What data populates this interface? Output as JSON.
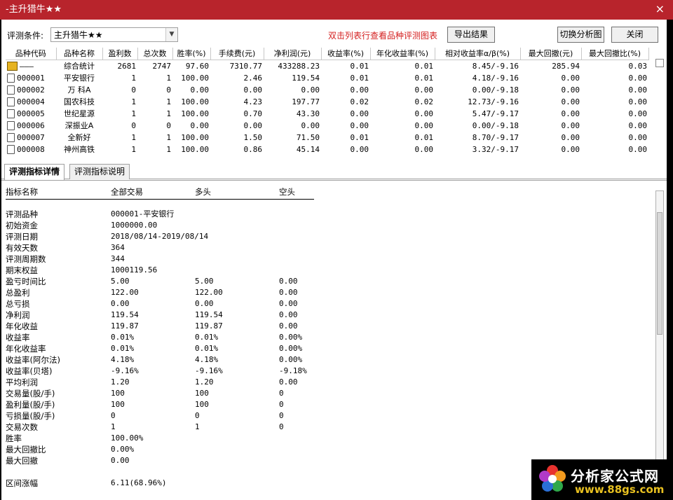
{
  "window": {
    "title": "-主升猎牛★★",
    "close_glyph": "×"
  },
  "toolbar": {
    "condition_label": "评测条件:",
    "condition_value": "主升猎牛★★",
    "hint": "双击列表行查看品种评测图表",
    "export_label": "导出结果",
    "switch_label": "切换分析图",
    "close_label": "关闭"
  },
  "grid": {
    "columns": [
      "品种代码",
      "品种名称",
      "盈利数",
      "总次数",
      "胜率(%)",
      "手续费(元)",
      "净利润(元)",
      "收益率(%)",
      "年化收益率(%)",
      "相对收益率α/β(%)",
      "最大回撤(元)",
      "最大回撤比(%)"
    ],
    "rows": [
      [
        "———",
        "综合统计",
        "2681",
        "2747",
        "97.60",
        "7310.77",
        "433288.23",
        "0.01",
        "0.01",
        "8.45/-9.16",
        "285.94",
        "0.03"
      ],
      [
        "000001",
        "平安银行",
        "1",
        "1",
        "100.00",
        "2.46",
        "119.54",
        "0.01",
        "0.01",
        "4.18/-9.16",
        "0.00",
        "0.00"
      ],
      [
        "000002",
        "万 科A",
        "0",
        "0",
        "0.00",
        "0.00",
        "0.00",
        "0.00",
        "0.00",
        "0.00/-9.18",
        "0.00",
        "0.00"
      ],
      [
        "000004",
        "国农科技",
        "1",
        "1",
        "100.00",
        "4.23",
        "197.77",
        "0.02",
        "0.02",
        "12.73/-9.16",
        "0.00",
        "0.00"
      ],
      [
        "000005",
        "世纪星源",
        "1",
        "1",
        "100.00",
        "0.70",
        "43.30",
        "0.00",
        "0.00",
        "5.47/-9.17",
        "0.00",
        "0.00"
      ],
      [
        "000006",
        "深振业A",
        "0",
        "0",
        "0.00",
        "0.00",
        "0.00",
        "0.00",
        "0.00",
        "0.00/-9.18",
        "0.00",
        "0.00"
      ],
      [
        "000007",
        "全新好",
        "1",
        "1",
        "100.00",
        "1.50",
        "71.50",
        "0.01",
        "0.01",
        "8.70/-9.17",
        "0.00",
        "0.00"
      ],
      [
        "000008",
        "神州高铁",
        "1",
        "1",
        "100.00",
        "0.86",
        "45.14",
        "0.00",
        "0.00",
        "3.32/-9.17",
        "0.00",
        "0.00"
      ]
    ]
  },
  "tabs": [
    {
      "label": "评测指标详情"
    },
    {
      "label": "评测指标说明"
    }
  ],
  "detail": {
    "headers": [
      "指标名称",
      "全部交易",
      "多头",
      "空头"
    ],
    "rows": [
      [
        "评测品种",
        "000001-平安银行",
        "",
        ""
      ],
      [
        "初始资金",
        "1000000.00",
        "",
        ""
      ],
      [
        "评测日期",
        "2018/08/14-2019/08/14",
        "",
        ""
      ],
      [
        "有效天数",
        "364",
        "",
        ""
      ],
      [
        "评测周期数",
        "344",
        "",
        ""
      ],
      [
        "期末权益",
        "1000119.56",
        "",
        ""
      ],
      [
        "盈亏时间比",
        "5.00",
        "5.00",
        "0.00"
      ],
      [
        "总盈利",
        "122.00",
        "122.00",
        "0.00"
      ],
      [
        "总亏损",
        "0.00",
        "0.00",
        "0.00"
      ],
      [
        "净利润",
        "119.54",
        "119.54",
        "0.00"
      ],
      [
        "年化收益",
        "119.87",
        "119.87",
        "0.00"
      ],
      [
        "收益率",
        "0.01%",
        "0.01%",
        "0.00%"
      ],
      [
        "年化收益率",
        "0.01%",
        "0.01%",
        "0.00%"
      ],
      [
        "收益率(阿尔法)",
        "4.18%",
        "4.18%",
        "0.00%"
      ],
      [
        "收益率(贝塔)",
        "-9.16%",
        "-9.16%",
        "-9.18%"
      ],
      [
        "平均利润",
        "1.20",
        "1.20",
        "0.00"
      ],
      [
        "交易量(股/手)",
        "100",
        "100",
        "0"
      ],
      [
        "盈利量(股/手)",
        "100",
        "100",
        "0"
      ],
      [
        "亏损量(股/手)",
        "0",
        "0",
        "0"
      ],
      [
        "交易次数",
        "1",
        "1",
        "0"
      ],
      [
        "胜率",
        "100.00%",
        "",
        ""
      ],
      [
        "最大回撤比",
        "0.00%",
        "",
        ""
      ],
      [
        "最大回撤",
        "0.00",
        "",
        ""
      ],
      [
        "",
        "",
        "",
        ""
      ],
      [
        "区间涨幅",
        "6.11(68.96%)",
        "",
        ""
      ]
    ]
  },
  "watermark": {
    "title": "分析家公式网",
    "url": "www.88gs.com"
  },
  "colors": {
    "titlebar": "#b8242c",
    "hint": "#d42020",
    "watermark_url": "#e8c020"
  },
  "icons": {
    "summary_row": "folder-icon",
    "stock_row": "file-icon",
    "combo": "chevron-down-icon",
    "close": "close-icon"
  }
}
